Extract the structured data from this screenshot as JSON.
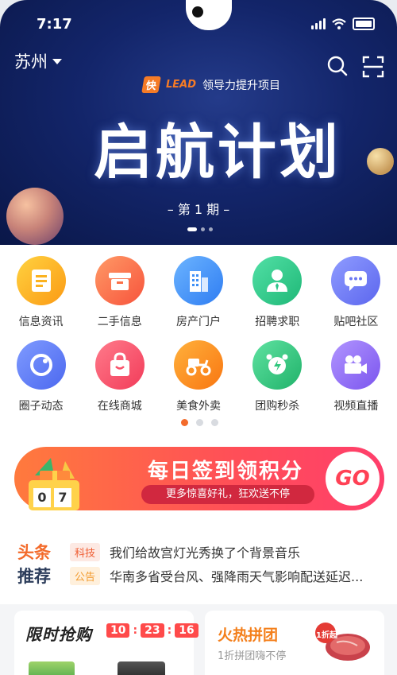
{
  "status": {
    "time": "7:17"
  },
  "header": {
    "city": "苏州"
  },
  "banner": {
    "brand_badge": "快",
    "brand_word": "LEAD",
    "brand_tagline": "领导力提升项目",
    "title": "启航计划",
    "issue": "– 第 1 期 –"
  },
  "categories": [
    {
      "label": "信息资讯",
      "icon": "news-icon",
      "color": "#fbb21f"
    },
    {
      "label": "二手信息",
      "icon": "box-icon",
      "color": "#fb7047"
    },
    {
      "label": "房产门户",
      "icon": "building-icon",
      "color": "#3d8ff6"
    },
    {
      "label": "招聘求职",
      "icon": "person-icon",
      "color": "#2ec58a"
    },
    {
      "label": "贴吧社区",
      "icon": "chat-icon",
      "color": "#6b78f2"
    },
    {
      "label": "圈子动态",
      "icon": "circle-chat-icon",
      "color": "#5f7ef3"
    },
    {
      "label": "在线商城",
      "icon": "shopping-bag-icon",
      "color": "#f9526a"
    },
    {
      "label": "美食外卖",
      "icon": "scooter-icon",
      "color": "#fb8c1e"
    },
    {
      "label": "团购秒杀",
      "icon": "alarm-clock-icon",
      "color": "#2fc67c"
    },
    {
      "label": "视频直播",
      "icon": "video-camera-icon",
      "color": "#8e6af1"
    }
  ],
  "signin": {
    "title": "每日签到领积分",
    "subtitle": "更多惊喜好礼，狂欢送不停",
    "go": "GO",
    "days": [
      "0",
      "7"
    ]
  },
  "headlines": {
    "logo_line1": "头条",
    "logo_line2": "推荐",
    "items": [
      {
        "tag": "科技",
        "text": "我们给故宫灯光秀换了个背景音乐"
      },
      {
        "tag": "公告",
        "text": "华南多省受台风、强降雨天气影响配送延迟..."
      }
    ]
  },
  "flash_sale": {
    "title": "限时抢购",
    "hours": "10",
    "minutes": "23",
    "seconds": "16"
  },
  "group_buy": {
    "title": "火热拼团",
    "subtitle": "1折拼团嗨不停",
    "badge": "1折起"
  }
}
